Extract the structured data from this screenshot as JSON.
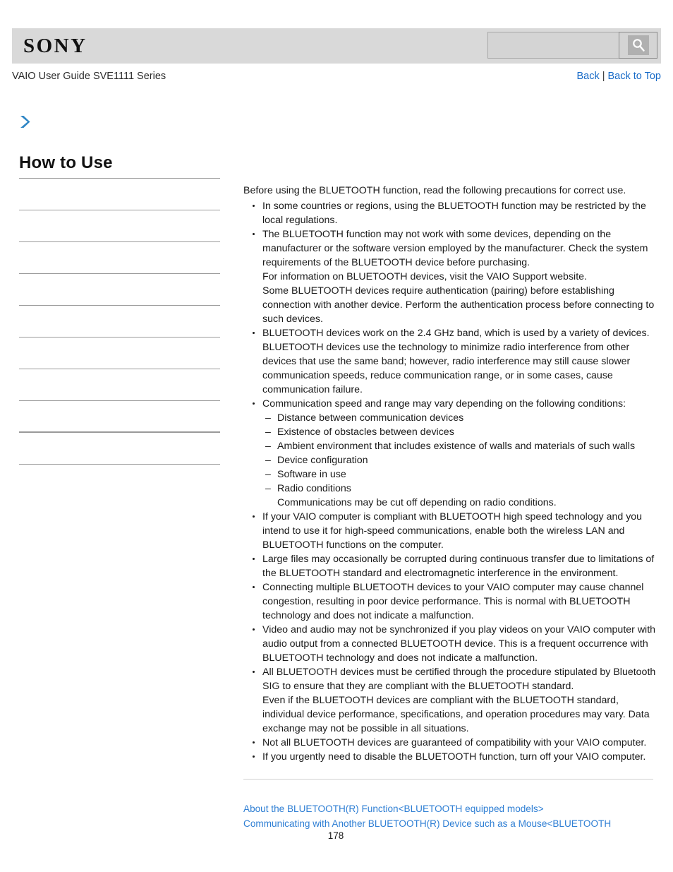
{
  "header": {
    "logo": "SONY",
    "search": {
      "value": "",
      "placeholder": "",
      "icon": "search-icon"
    }
  },
  "subheader": {
    "guide_title": "VAIO User Guide SVE1111 Series",
    "back_label": "Back",
    "separator": "|",
    "back_to_top_label": "Back to Top"
  },
  "sidebar": {
    "breadcrumb_icon": "chevron-right-icon",
    "title": "How to Use",
    "items": [
      {
        "label": "",
        "thick": false
      },
      {
        "label": "",
        "thick": false
      },
      {
        "label": "",
        "thick": false
      },
      {
        "label": "",
        "thick": false
      },
      {
        "label": "",
        "thick": false
      },
      {
        "label": "",
        "thick": false
      },
      {
        "label": "",
        "thick": false
      },
      {
        "label": "",
        "thick": true
      },
      {
        "label": "",
        "thick": false
      }
    ]
  },
  "content": {
    "intro": "Before using the BLUETOOTH function, read the following precautions for correct use.",
    "bullets": [
      {
        "paragraphs": [
          "In some countries or regions, using the BLUETOOTH function may be restricted by the local regulations."
        ]
      },
      {
        "paragraphs": [
          "The BLUETOOTH function may not work with some devices, depending on the manufacturer or the software version employed by the manufacturer. Check the system requirements of the BLUETOOTH device before purchasing.",
          "For information on BLUETOOTH devices, visit the VAIO Support website.",
          "Some BLUETOOTH devices require authentication (pairing) before establishing connection with another device. Perform the authentication process before connecting to such devices."
        ]
      },
      {
        "paragraphs": [
          "BLUETOOTH devices work on the 2.4 GHz band, which is used by a variety of devices. BLUETOOTH devices use the technology to minimize radio interference from other devices that use the same band; however, radio interference may still cause slower communication speeds, reduce communication range, or in some cases, cause communication failure."
        ]
      },
      {
        "paragraphs": [
          "Communication speed and range may vary depending on the following conditions:"
        ],
        "sub_items": [
          "Distance between communication devices",
          "Existence of obstacles between devices",
          "Ambient environment that includes existence of walls and materials of such walls",
          "Device configuration",
          "Software in use",
          "Radio conditions"
        ],
        "sub_note": "Communications may be cut off depending on radio conditions."
      },
      {
        "paragraphs": [
          "If your VAIO computer is compliant with BLUETOOTH high speed technology and you intend to use it for high-speed communications, enable both the wireless LAN and BLUETOOTH functions on the computer."
        ]
      },
      {
        "paragraphs": [
          "Large files may occasionally be corrupted during continuous transfer due to limitations of the BLUETOOTH standard and electromagnetic interference in the environment."
        ]
      },
      {
        "paragraphs": [
          "Connecting multiple BLUETOOTH devices to your VAIO computer may cause channel congestion, resulting in poor device performance. This is normal with BLUETOOTH technology and does not indicate a malfunction."
        ]
      },
      {
        "paragraphs": [
          "Video and audio may not be synchronized if you play videos on your VAIO computer with audio output from a connected BLUETOOTH device. This is a frequent occurrence with BLUETOOTH technology and does not indicate a malfunction."
        ]
      },
      {
        "paragraphs": [
          "All BLUETOOTH devices must be certified through the procedure stipulated by Bluetooth SIG to ensure that they are compliant with the BLUETOOTH standard.",
          "Even if the BLUETOOTH devices are compliant with the BLUETOOTH standard, individual device performance, specifications, and operation procedures may vary. Data exchange may not be possible in all situations."
        ]
      },
      {
        "paragraphs": [
          "Not all BLUETOOTH devices are guaranteed of compatibility with your VAIO computer."
        ]
      },
      {
        "paragraphs": [
          "If you urgently need to disable the BLUETOOTH function, turn off your VAIO computer."
        ]
      }
    ]
  },
  "footer": {
    "links": [
      "About the BLUETOOTH(R) Function<BLUETOOTH equipped models>",
      "Communicating with Another BLUETOOTH(R) Device such as a Mouse<BLUETOOTH"
    ],
    "page_number": "178"
  },
  "colors": {
    "header_bg": "#d9d9d9",
    "link_blue": "#1569c7",
    "footer_link_blue": "#2f7fd4",
    "chevron_blue": "#2f86c5",
    "divider_gray": "#9a9a9a"
  }
}
